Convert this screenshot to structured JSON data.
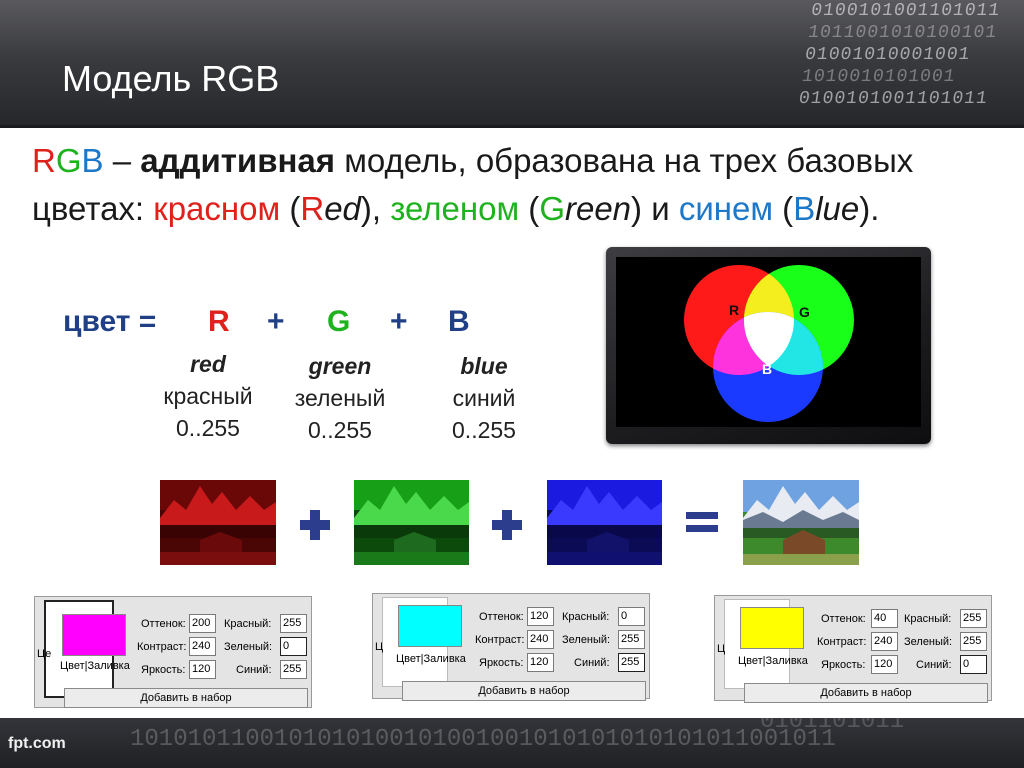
{
  "header": {
    "title": "Модель RGB",
    "binary_rows": [
      "0100101001101011",
      "1011001010100101",
      "01001010001001",
      "1010010101001"
    ]
  },
  "intro": {
    "r": "R",
    "g": "G",
    "b": "B",
    "dash": " – ",
    "additive": "аддитивная",
    "part1": " модель, образована на трех базовых цветах: ",
    "red_word": "красном",
    "open1": " (",
    "red_first": "R",
    "red_rest": "ed",
    "close1": "), ",
    "green_word": "зеленом",
    "open2": " (",
    "green_first": "G",
    "green_rest": "reen",
    "close2": ") и ",
    "blue_word": "синем",
    "open3": " (",
    "blue_first": "B",
    "blue_rest": "lue",
    "close3": ")."
  },
  "formula": {
    "lhs": "цвет =",
    "r": "R",
    "plus": "+",
    "g": "G",
    "b": "B"
  },
  "components": [
    {
      "en": "red",
      "ru": "красный",
      "range": "0..255"
    },
    {
      "en": "green",
      "ru": "зеленый",
      "range": "0..255"
    },
    {
      "en": "blue",
      "ru": "синий",
      "range": "0..255"
    }
  ],
  "diagram": {
    "label_r": "R",
    "label_g": "G",
    "label_b": "B",
    "colors": {
      "red": "#ff1a1a",
      "green": "#1aff1a",
      "blue": "#1a3bff",
      "yellow": "#f5ee1e",
      "cyan": "#22e6e6",
      "magenta": "#ff33dd",
      "white": "#ffffff"
    }
  },
  "dialogs": [
    {
      "swatch_color": "#ff00ff",
      "hue_label": "Оттенок:",
      "hue": "200",
      "contrast_label": "Контраст:",
      "contrast": "240",
      "brightness_label": "Яркость:",
      "brightness": "120",
      "red_label": "Красный:",
      "red": "255",
      "green_label": "Зеленый:",
      "green": "0",
      "blue_label": "Синий:",
      "blue": "255",
      "caption": "Цвет|Заливка",
      "button": "Добавить в набор",
      "cut_label": "Це"
    },
    {
      "swatch_color": "#00ffff",
      "hue_label": "Оттенок:",
      "hue": "120",
      "contrast_label": "Контраст:",
      "contrast": "240",
      "brightness_label": "Яркость:",
      "brightness": "120",
      "red_label": "Красный:",
      "red": "0",
      "green_label": "Зеленый:",
      "green": "255",
      "blue_label": "Синий:",
      "blue": "255",
      "caption": "Цвет|Заливка",
      "button": "Добавить в набор",
      "cut_label": "Ц"
    },
    {
      "swatch_color": "#ffff00",
      "hue_label": "Оттенок:",
      "hue": "40",
      "contrast_label": "Контраст:",
      "contrast": "240",
      "brightness_label": "Яркость:",
      "brightness": "120",
      "red_label": "Красный:",
      "red": "255",
      "green_label": "Зеленый:",
      "green": "255",
      "blue_label": "Синий:",
      "blue": "0",
      "caption": "Цвет|Заливка",
      "button": "Добавить в набор",
      "cut_label": "Ц"
    }
  ],
  "footer": {
    "brand": "fpt.com",
    "binary": "1010101100101010100101001001010101010101011001011",
    "binary_top": "0101101011"
  },
  "colors": {
    "accent_dark": "#1f3f86",
    "red": "#e0201b",
    "green": "#1fb21f",
    "blue": "#1e78c8",
    "operator": "#2b3d8c"
  }
}
